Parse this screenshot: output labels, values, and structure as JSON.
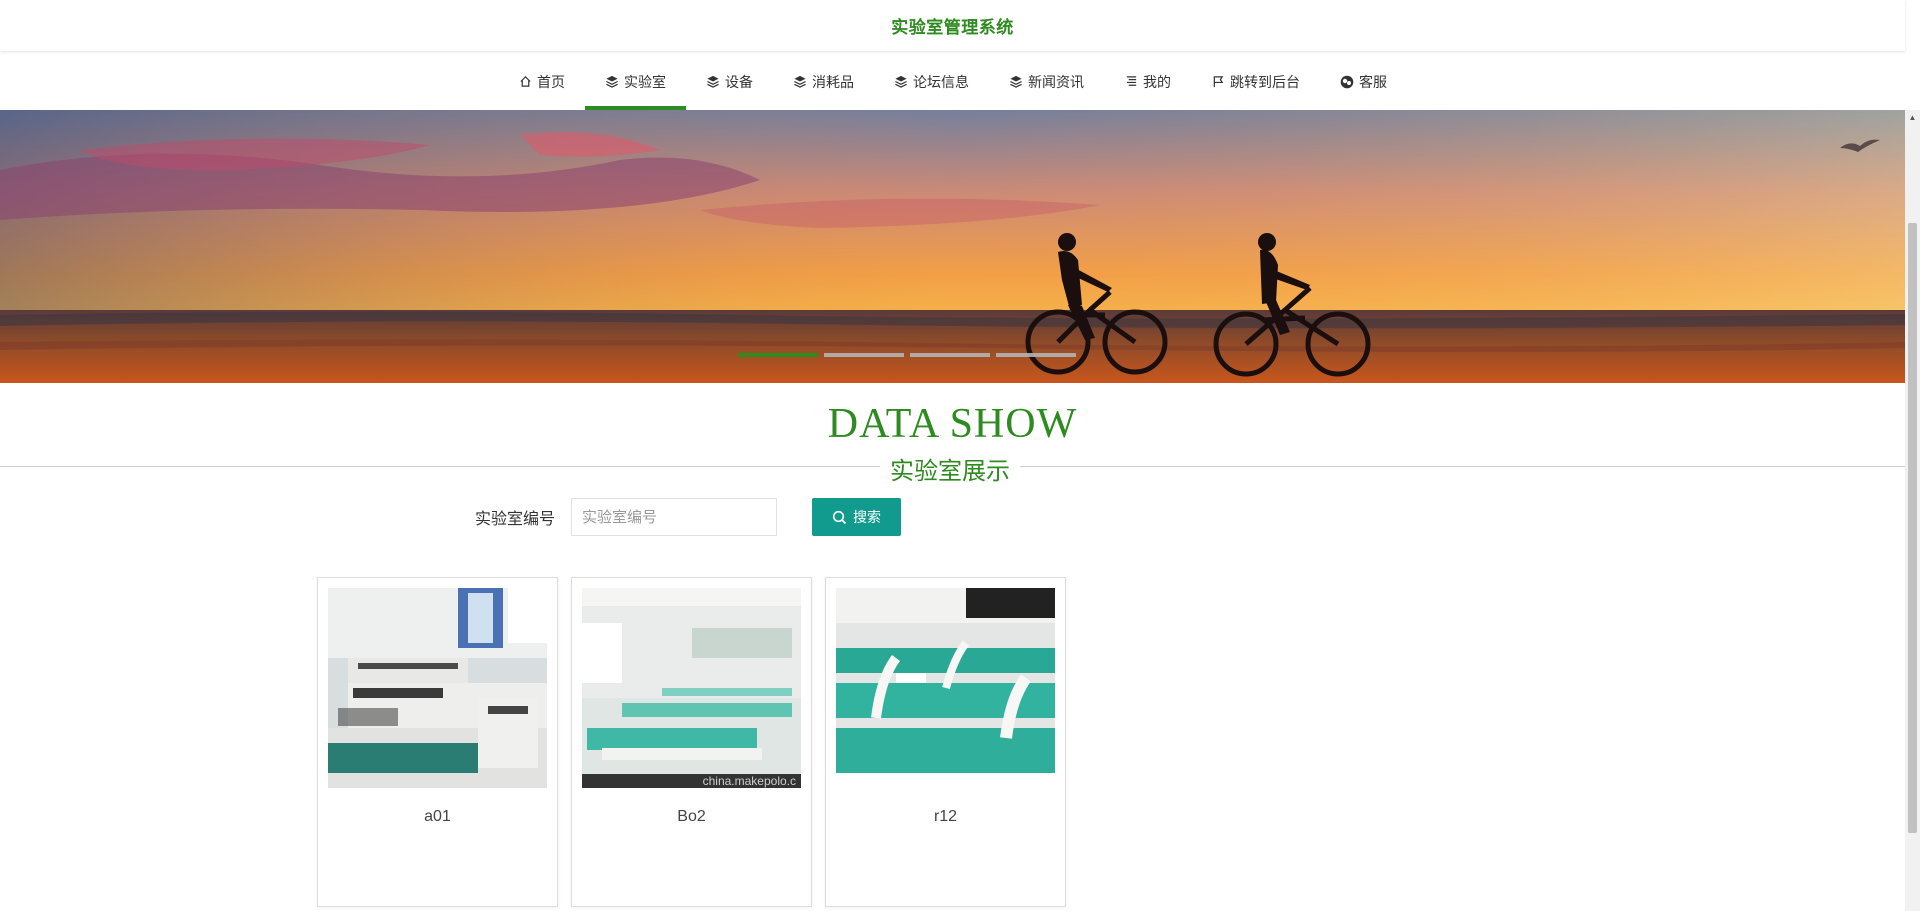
{
  "site": {
    "title": "实验室管理系统"
  },
  "nav": {
    "items": [
      {
        "label": "首页",
        "icon": "home-icon",
        "active": false
      },
      {
        "label": "实验室",
        "icon": "layers-icon",
        "active": true
      },
      {
        "label": "设备",
        "icon": "layers-icon",
        "active": false
      },
      {
        "label": "消耗品",
        "icon": "layers-icon",
        "active": false
      },
      {
        "label": "论坛信息",
        "icon": "layers-icon",
        "active": false
      },
      {
        "label": "新闻资讯",
        "icon": "layers-icon",
        "active": false
      },
      {
        "label": "我的",
        "icon": "list-icon",
        "active": false
      },
      {
        "label": "跳转到后台",
        "icon": "flag-icon",
        "active": false
      },
      {
        "label": "客服",
        "icon": "chat-icon",
        "active": false
      }
    ]
  },
  "banner": {
    "slide_count": 4,
    "active_slide": 1
  },
  "section": {
    "title": "DATA SHOW",
    "subtitle": "实验室展示"
  },
  "search": {
    "label": "实验室编号",
    "placeholder": "实验室编号",
    "value": "",
    "button_label": "搜索"
  },
  "labs": [
    {
      "name": "a01"
    },
    {
      "name": "Bo2",
      "watermark": "china.makepolo.c"
    },
    {
      "name": "r12"
    }
  ],
  "colors": {
    "accent": "#2e8b1f",
    "button": "#119a8e"
  }
}
